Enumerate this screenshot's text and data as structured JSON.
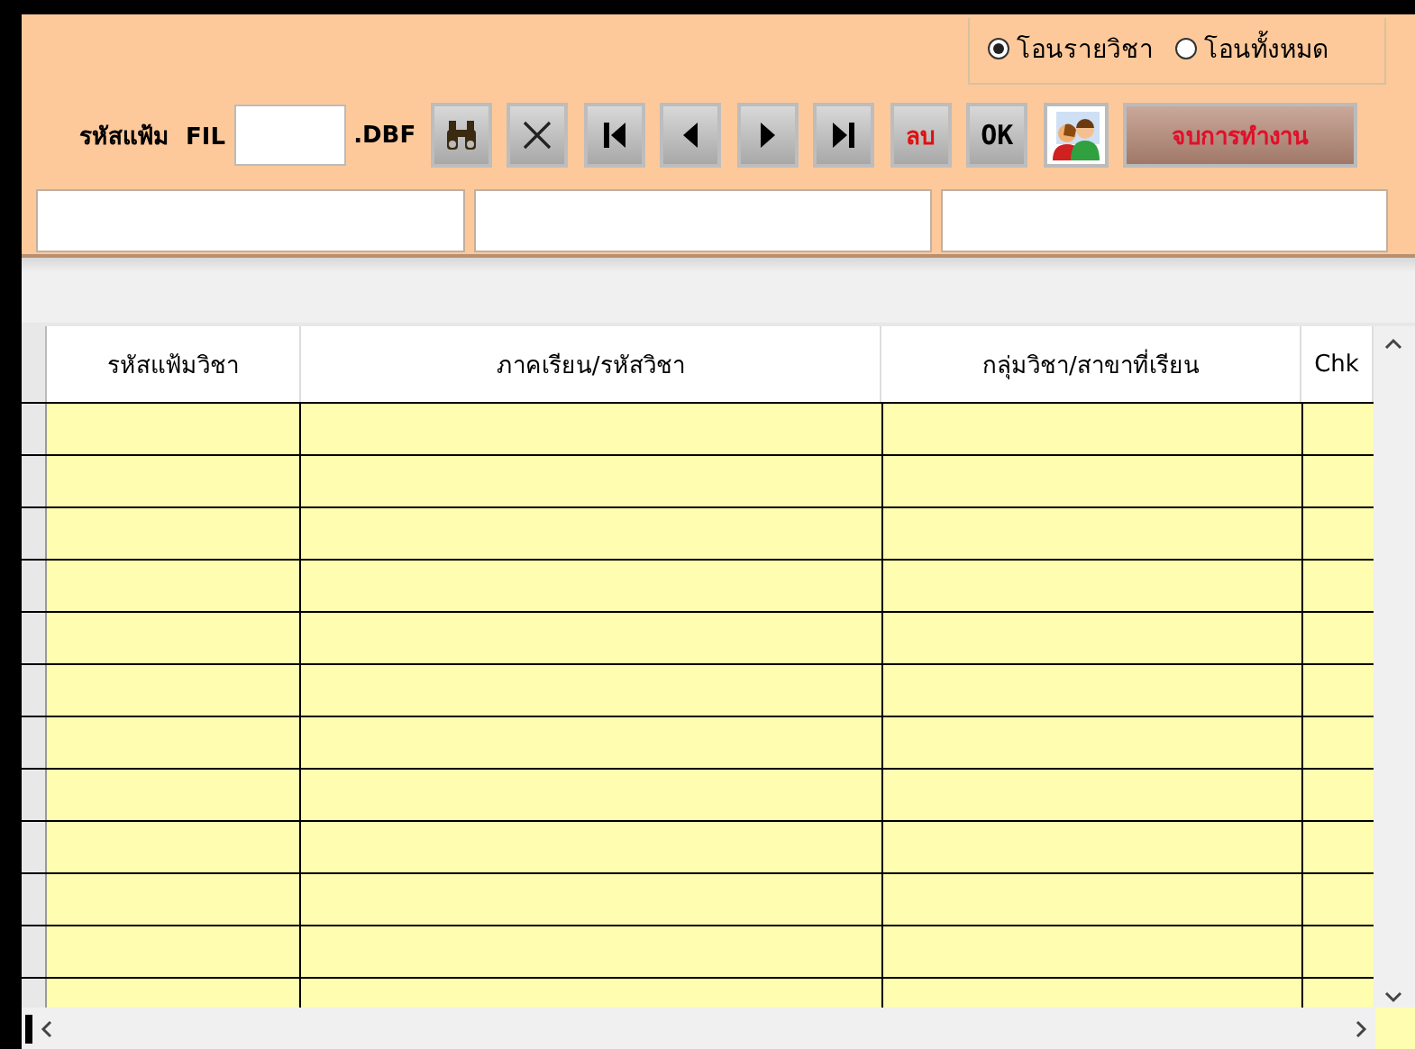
{
  "transfer_mode": [
    {
      "label": "โอนรายวิชา",
      "selected": true
    },
    {
      "label": "โอนทั้งหมด",
      "selected": false
    }
  ],
  "file_code": {
    "label": "รหัสแฟ้ม  FIL",
    "suffix": ".DBF"
  },
  "delete_button": {
    "label": "ลบ"
  },
  "ok_button": {
    "label": "OK"
  },
  "exit_button": {
    "label": "จบการทำงาน"
  },
  "table": {
    "columns": [
      "รหัสแฟ้มวิชา",
      "ภาคเรียน/รหัสวิชา",
      "กลุ่มวิชา/สาขาที่เรียน",
      "Chk"
    ]
  }
}
